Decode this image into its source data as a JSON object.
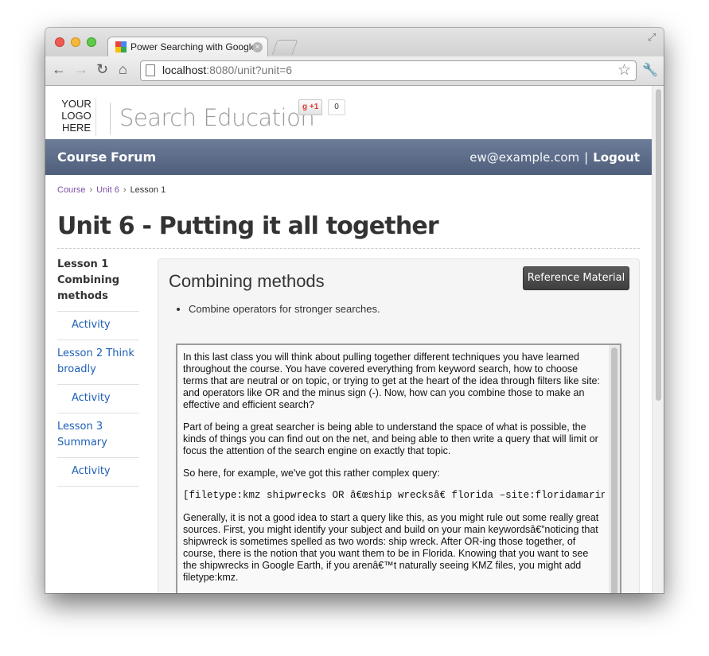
{
  "browser": {
    "tab_title": "Power Searching with Google",
    "tab_close": "×",
    "url_host": "localhost",
    "url_rest": ":8080/unit?unit=6",
    "back": "←",
    "forward": "→",
    "reload": "↻",
    "home": "⌂",
    "star": "☆",
    "wrench": "🔧",
    "fullscreen": "⤢"
  },
  "header": {
    "logo_lines": [
      "YOUR",
      "LOGO",
      "HERE"
    ],
    "site_title": "Search Education",
    "gplus_label": "+1",
    "gplus_count": "0"
  },
  "nav": {
    "course": "Course",
    "forum": "Forum",
    "email": "ew@example.com",
    "separator": "|",
    "logout": "Logout"
  },
  "breadcrumb": {
    "items": [
      "Course",
      "Unit 6",
      "Lesson 1"
    ],
    "separator": "›"
  },
  "page_title": "Unit 6 - Putting it all together",
  "sidebar": {
    "items": [
      {
        "label": "Lesson 1 Combining methods",
        "type": "current"
      },
      {
        "label": "Activity",
        "type": "activity"
      },
      {
        "label": "Lesson 2 Think broadly",
        "type": "lesson"
      },
      {
        "label": "Activity",
        "type": "activity"
      },
      {
        "label": "Lesson 3 Summary",
        "type": "lesson"
      },
      {
        "label": "Activity",
        "type": "activity"
      }
    ]
  },
  "lesson": {
    "title": "Combining methods",
    "reference_button": "Reference Material",
    "objectives": [
      "Combine operators for stronger searches."
    ],
    "transcript": [
      "In this last class you will think about pulling together different techniques you have learned throughout the course. You have covered everything from keyword search, how to choose terms that are neutral or on topic, or trying to get at the heart of the idea through filters like site: and operators like OR and the minus sign (-). Now, how can you combine those to make an effective and efficient search?",
      "Part of being a great searcher is being able to understand the space of what is possible, the kinds of things you can find out on the net, and being able to then write a query that will limit or focus the attention of the search engine on exactly that topic.",
      "So here, for example, we've got this rather complex query:",
      "[filetype:kmz shipwrecks OR â€œship wrecksâ€ florida –site:floridamarine",
      "Generally, it is not a good idea to start a query like this, as you might rule out some really great sources. First, you might identify your subject and build on your main keywordsâ€”noticing that shipwreck is sometimes spelled as two words: ship wreck. After OR-ing those together, of course, there is the notion that you want them to be in Florida. Knowing that you want to see the shipwrecks in Google Earth, if you arenâ€™t naturally seeing KMZ files, you might add filetype:kmz."
    ]
  }
}
